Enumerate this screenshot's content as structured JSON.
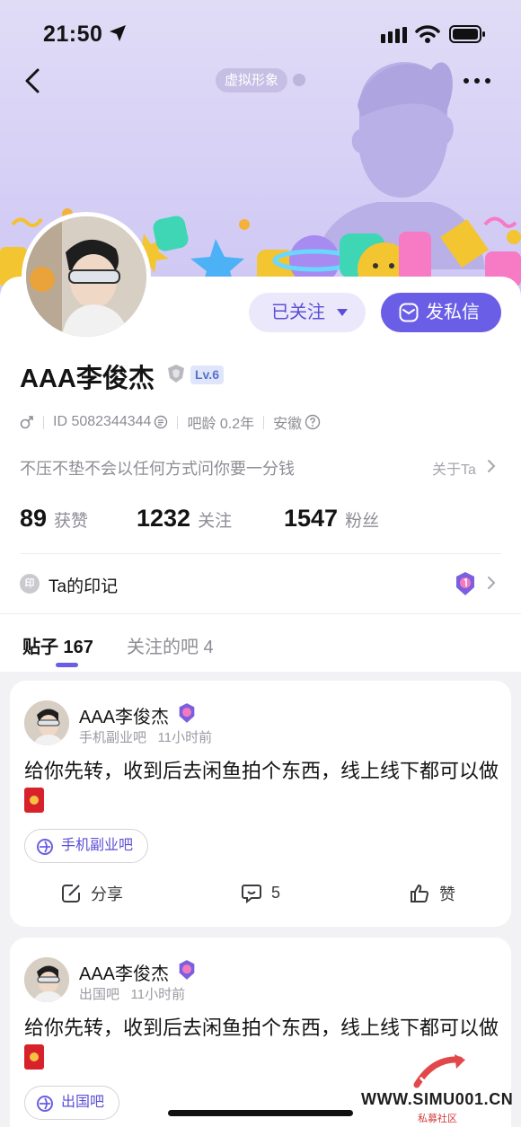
{
  "status": {
    "time": "21:50"
  },
  "header": {
    "virtual_tag": "虚拟形象"
  },
  "profile": {
    "follow_label": "已关注",
    "message_label": "发私信",
    "username": "AAA李俊杰",
    "level": "Lv.6",
    "id_text": "ID 5082344344",
    "age_text": "吧龄 0.2年",
    "location": "安徽",
    "bio": "不压不垫不会以任何方式问你要一分钱",
    "about_label": "关于Ta"
  },
  "stats": [
    {
      "value": "89",
      "label": "获赞"
    },
    {
      "value": "1232",
      "label": "关注"
    },
    {
      "value": "1547",
      "label": "粉丝"
    }
  ],
  "mark": {
    "badge": "印",
    "label": "Ta的印记"
  },
  "tabs": {
    "posts_label": "贴子 167",
    "forums_label": "关注的吧 4"
  },
  "posts": [
    {
      "author": "AAA李俊杰",
      "forum": "手机副业吧",
      "time": "11小时前",
      "text": "给你先转，收到后去闲鱼拍个东西，线上线下都可以做",
      "tag": "手机副业吧",
      "share_label": "分享",
      "comment_count": "5",
      "like_label": "赞"
    },
    {
      "author": "AAA李俊杰",
      "forum": "出国吧",
      "time": "11小时前",
      "text": "给你先转，收到后去闲鱼拍个东西，线上线下都可以做",
      "tag": "出国吧"
    }
  ],
  "watermark": {
    "text": "WWW.SIMU001.CN",
    "sub": "私募社区"
  },
  "colors": {
    "accent": "#6a5ee6",
    "banner": "#d7d1f6"
  }
}
